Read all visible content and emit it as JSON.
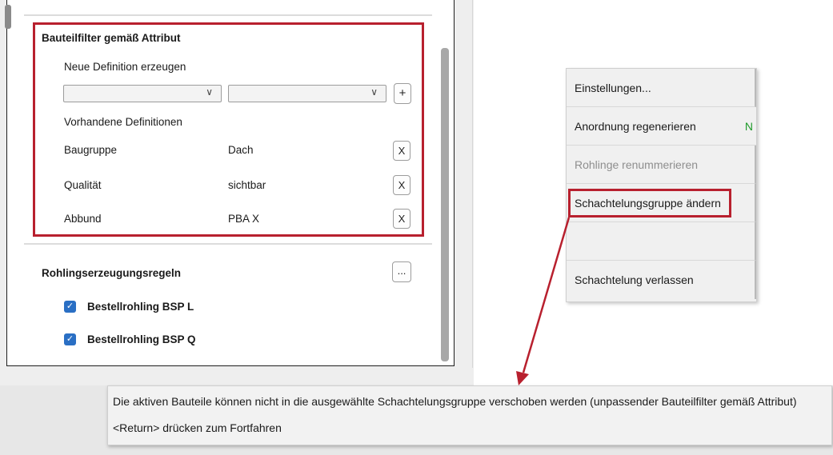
{
  "filter_section": {
    "title": "Bauteilfilter gemäß Attribut",
    "new_definition_label": "Neue Definition erzeugen",
    "dropdown1_value": "",
    "dropdown2_value": "",
    "chevron": "∨",
    "add_button": "+",
    "existing_definitions_label": "Vorhandene Definitionen",
    "definitions": [
      {
        "attribute": "Baugruppe",
        "value": "Dach",
        "remove": "X"
      },
      {
        "attribute": "Qualität",
        "value": "sichtbar",
        "remove": "X"
      },
      {
        "attribute": "Abbund",
        "value": "PBA X",
        "remove": "X"
      }
    ]
  },
  "blank_rules": {
    "title": "Rohlingserzeugungsregeln",
    "more_button": "...",
    "items": [
      {
        "label": "Bestellrohling BSP L",
        "checked": true
      },
      {
        "label": "Bestellrohling BSP Q",
        "checked": true
      }
    ]
  },
  "context_menu": {
    "items": [
      {
        "label": "Einstellungen...",
        "shortcut": "",
        "enabled": true
      },
      {
        "label": "Anordnung regenerieren",
        "shortcut": "N",
        "enabled": true
      },
      {
        "label": "Rohlinge renummerieren",
        "shortcut": "",
        "enabled": false
      },
      {
        "label": "Schachtelungsgruppe ändern",
        "shortcut": "",
        "enabled": true
      },
      {
        "label": "",
        "shortcut": "",
        "enabled": true
      },
      {
        "label": "Schachtelung verlassen",
        "shortcut": "",
        "enabled": true
      }
    ]
  },
  "message": {
    "line1": "Die aktiven Bauteile können nicht in die ausgewählte Schachtelungsgruppe verschoben werden (unpassender Bauteilfilter gemäß Attribut)",
    "line2": "<Return> drücken zum Fortfahren"
  },
  "colors": {
    "highlight_red": "#b8202e",
    "checkbox_blue": "#2a6fc4",
    "shortcut_green": "#1f9a2a"
  }
}
